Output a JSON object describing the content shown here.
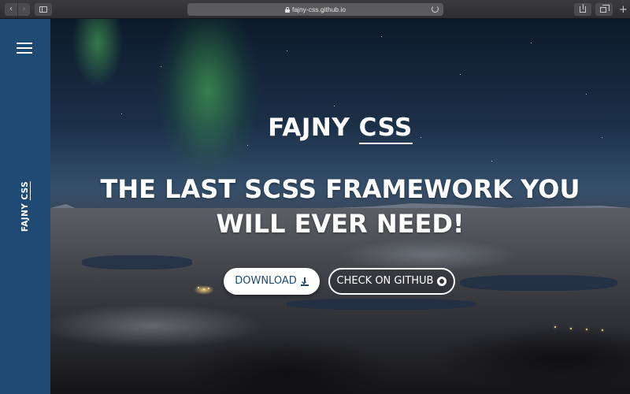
{
  "browser": {
    "back_glyph": "‹",
    "forward_glyph": "›",
    "url": "fajny-css.github.io",
    "newtab_glyph": "+",
    "icons": [
      "chevron-left-icon",
      "chevron-right-icon",
      "sidebar-icon",
      "lock-icon",
      "reload-icon",
      "share-icon",
      "tabs-icon",
      "plus-icon"
    ]
  },
  "sidebar": {
    "brand_main": "FAJNY",
    "brand_accent": "CSS",
    "menu_icon": "hamburger-icon",
    "color": "#1e4a74"
  },
  "hero": {
    "title_main": "FAJNY",
    "title_accent": "CSS",
    "tagline": "THE LAST SCSS FRAMEWORK YOU WILL EVER NEED!",
    "download_label": "DOWNLOAD",
    "download_icon": "download-icon",
    "github_label": "CHECK ON GITHUB",
    "github_icon": "github-icon",
    "background": "night sky aurora over snowy landscape"
  }
}
